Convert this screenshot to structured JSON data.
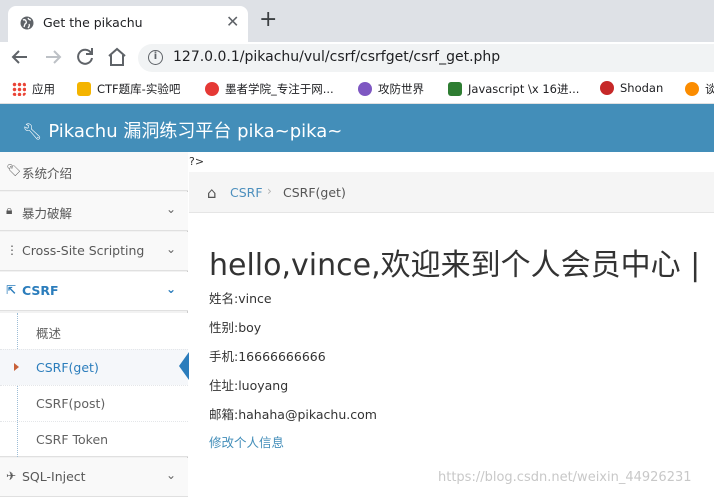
{
  "browser": {
    "tab_title": "Get the pikachu",
    "close_glyph": "✕",
    "new_tab_glyph": "+",
    "url": "127.0.0.1/pikachu/vul/csrf/csrfget/csrf_get.php",
    "bookmarks": [
      {
        "label": "应用",
        "icon": "apps-grid-icon",
        "color": "#1a73e8"
      },
      {
        "label": "CTF题库-实验吧",
        "icon": "ctf-icon",
        "color": "#f4b400"
      },
      {
        "label": "墨者学院_专注于网...",
        "icon": "mozhe-icon",
        "color": "#e53935"
      },
      {
        "label": "攻防世界",
        "icon": "adworld-icon",
        "color": "#7e57c2"
      },
      {
        "label": "Javascript \\x 16进...",
        "icon": "javascript-icon",
        "color": "#2e7d32"
      },
      {
        "label": "Shodan",
        "icon": "shodan-icon",
        "color": "#c62828"
      },
      {
        "label": "谈",
        "icon": "bookmark-icon",
        "color": "#fb8c00"
      }
    ]
  },
  "app": {
    "title": "Pikachu 漏洞练习平台 pika~pika~",
    "header_color": "#438eb9"
  },
  "sidebar": {
    "items": [
      {
        "label": "系统介绍",
        "icon": "tags-icon"
      },
      {
        "label": "暴力破解",
        "icon": "lock-icon"
      },
      {
        "label": "Cross-Site Scripting",
        "icon": "sitemap-icon"
      },
      {
        "label": "CSRF",
        "icon": "share-icon"
      },
      {
        "label": "SQL-Inject",
        "icon": "fighter-jet-icon"
      }
    ],
    "csrf_subitems": [
      "概述",
      "CSRF(get)",
      "CSRF(post)",
      "CSRF Token"
    ]
  },
  "main": {
    "stray_text": "?>",
    "breadcrumb": {
      "link": "CSRF",
      "separator": "›",
      "current": "CSRF(get)"
    },
    "heading": "hello,vince,欢迎来到个人会员中心 |",
    "fields": [
      "姓名:vince",
      "性别:boy",
      "手机:16666666666",
      "住址:luoyang",
      "邮箱:hahaha@pikachu.com"
    ],
    "edit_link": "修改个人信息"
  },
  "watermark": "https://blog.csdn.net/weixin_44926231"
}
